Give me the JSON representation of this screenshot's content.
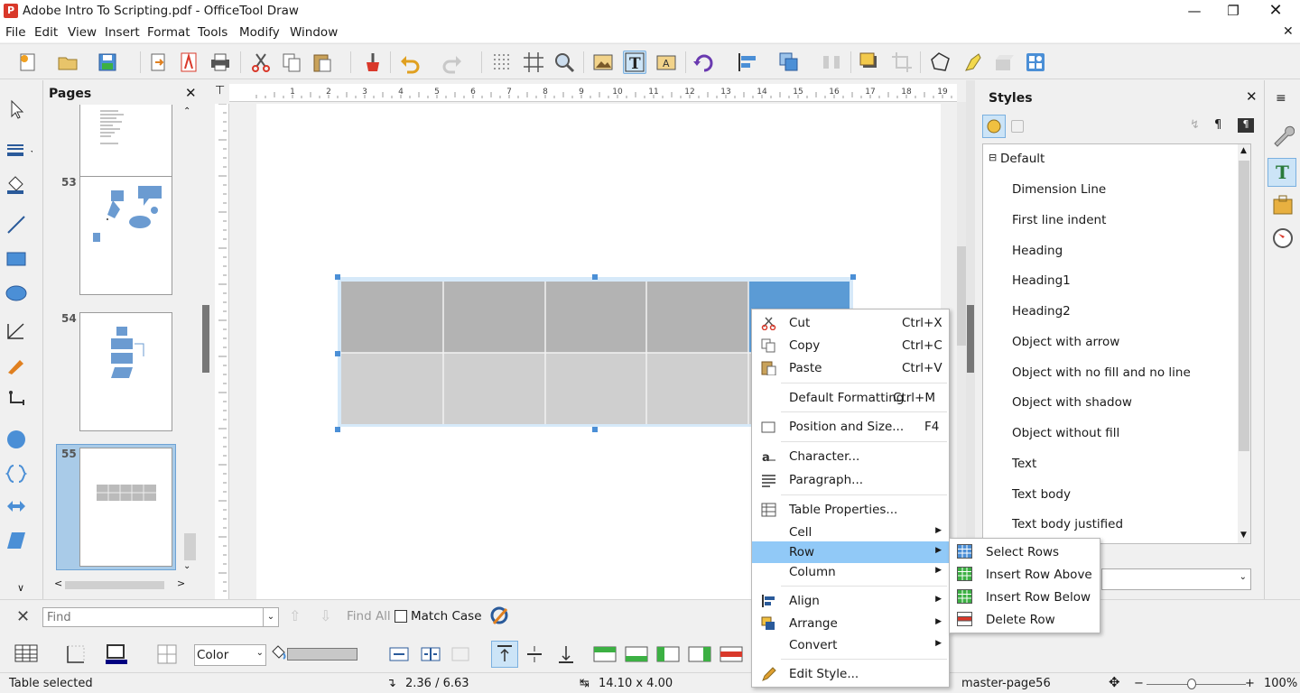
{
  "window": {
    "title": "Adobe Intro To Scripting.pdf - OfficeTool Draw",
    "app_icon": "pdf-app-icon"
  },
  "menu": [
    "File",
    "Edit",
    "View",
    "Insert",
    "Format",
    "Tools",
    "Modify",
    "Window"
  ],
  "pages_panel": {
    "title": "Pages",
    "pages": [
      {
        "number": "53"
      },
      {
        "number": "54"
      },
      {
        "number": "55"
      }
    ]
  },
  "styles_panel": {
    "title": "Styles",
    "root": "Default",
    "items": [
      "Dimension Line",
      "First line indent",
      "Heading",
      "Heading1",
      "Heading2",
      "Object with arrow",
      "Object with no fill and no line",
      "Object with shadow",
      "Object without fill",
      "Text",
      "Text body",
      "Text body justified"
    ]
  },
  "context_menu": {
    "items": [
      {
        "label": "Cut",
        "accel": "Ctrl+X",
        "icon": "scissors-icon"
      },
      {
        "label": "Copy",
        "accel": "Ctrl+C",
        "icon": "copy-icon"
      },
      {
        "label": "Paste",
        "accel": "Ctrl+V",
        "icon": "paste-icon"
      },
      {
        "label": "Default Formatting",
        "accel": "Ctrl+M"
      },
      {
        "label": "Position and Size...",
        "accel": "F4",
        "icon": "position-size-icon"
      },
      {
        "label": "Character...",
        "icon": "character-icon"
      },
      {
        "label": "Paragraph...",
        "icon": "paragraph-icon"
      },
      {
        "label": "Table Properties...",
        "icon": "table-properties-icon"
      },
      {
        "label": "Cell"
      },
      {
        "label": "Row",
        "highlighted": true
      },
      {
        "label": "Column"
      },
      {
        "label": "Align",
        "icon": "align-icon"
      },
      {
        "label": "Arrange",
        "icon": "arrange-icon"
      },
      {
        "label": "Convert"
      },
      {
        "label": "Edit Style...",
        "icon": "edit-style-icon"
      }
    ]
  },
  "row_submenu": {
    "items": [
      {
        "label": "Select Rows",
        "icon": "select-rows-icon",
        "color": "#4b8fd6"
      },
      {
        "label": "Insert Row Above",
        "icon": "insert-row-above-icon",
        "color": "#3cb043"
      },
      {
        "label": "Insert Row Below",
        "icon": "insert-row-below-icon",
        "color": "#3cb043"
      },
      {
        "label": "Delete Row",
        "icon": "delete-row-icon",
        "color": "#d9382a"
      }
    ]
  },
  "find_bar": {
    "placeholder": "Find",
    "find_all": "Find All",
    "match_case": "Match Case"
  },
  "table_toolbar": {
    "fill_type": "Color"
  },
  "status": {
    "selection": "Table selected",
    "position": "2.36 / 6.63",
    "size": "14.10 x 4.00",
    "master_page": "master-page56",
    "zoom": "100%"
  },
  "ruler": {
    "h_ticks": [
      "1",
      "2",
      "3",
      "4",
      "5",
      "6",
      "7",
      "8",
      "9",
      "10",
      "11",
      "12",
      "13",
      "14",
      "15",
      "16",
      "17",
      "18",
      "19"
    ]
  },
  "colors": {
    "selection_highlight": "#cce4f7",
    "menu_highlight": "#91c9f7",
    "accent": "#4b8fd6",
    "table_dark": "#b3b3b3",
    "table_light": "#cfcfcf",
    "table_selected_cell": "#5b9bd5",
    "current_page": "#a9cbe8"
  }
}
